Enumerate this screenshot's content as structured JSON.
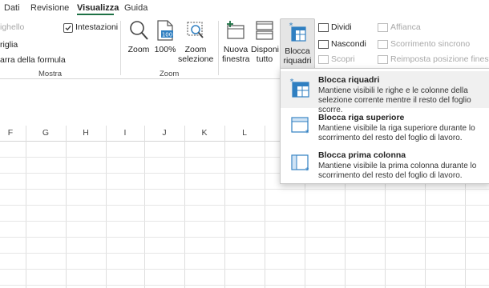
{
  "tabs": {
    "dati": "Dati",
    "revisione": "Revisione",
    "visualizza": "Visualizza",
    "guida": "Guida"
  },
  "ribbon": {
    "mostra": {
      "partial_top": "ighello",
      "griglia": "riglia",
      "barra_formula": "arra della formula",
      "intestazioni": "Intestazioni",
      "intestazioni_checked": true,
      "group_label": "Mostra"
    },
    "zoom": {
      "zoom": "Zoom",
      "zoom100": "100%",
      "zoom_sel_1": "Zoom",
      "zoom_sel_2": "selezione",
      "group_label": "Zoom"
    },
    "finestra": {
      "nuova_1": "Nuova",
      "nuova_2": "finestra",
      "disponi_1": "Disponi",
      "disponi_2": "tutto",
      "blocca_1": "Blocca",
      "blocca_2": "riquadri",
      "dividi": "Dividi",
      "nascondi": "Nascondi",
      "scopri": "Scopri",
      "affianca": "Affianca",
      "scorrimento": "Scorrimento sincrono",
      "reimposta": "Reimposta posizione finestra"
    }
  },
  "columns": [
    "F",
    "G",
    "H",
    "I",
    "J",
    "K",
    "L"
  ],
  "menu": {
    "items": [
      {
        "title": "Blocca riquadri",
        "desc": "Mantiene visibili le righe e le colonne della selezione corrente mentre il resto del foglio scorre."
      },
      {
        "title": "Blocca riga superiore",
        "desc": "Mantiene visibile la riga superiore durante lo scorrimento del resto del foglio di lavoro."
      },
      {
        "title": "Blocca prima colonna",
        "desc": "Mantiene visibile la prima colonna durante lo scorrimento del resto del foglio di lavoro."
      }
    ]
  },
  "colors": {
    "accent": "#1e7145",
    "icon_blue": "#2f7fc1",
    "menu_hover": "#f0f0f0"
  }
}
